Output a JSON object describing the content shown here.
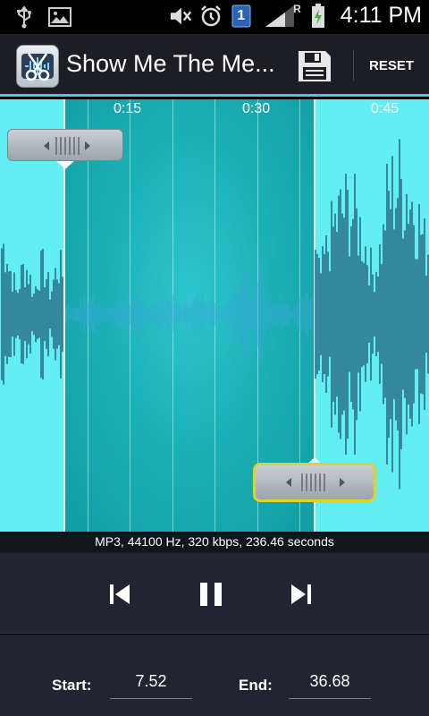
{
  "status_bar": {
    "time": "4:11 PM",
    "notification_badge": "1",
    "roaming_indicator": "R",
    "icons": [
      "usb-icon",
      "image-icon",
      "mute-icon",
      "alarm-icon",
      "notification-badge-icon",
      "signal-icon",
      "battery-charging-icon"
    ]
  },
  "action_bar": {
    "title": "Show Me The Me...",
    "app_icon": "scissors-app-icon",
    "save_icon": "floppy-save-icon",
    "reset_label": "RESET"
  },
  "waveform": {
    "time_marks": [
      "0:15",
      "0:30",
      "0:45"
    ],
    "selection_color": "#1bb1b6",
    "background_color": "#62eef2",
    "wave_color": "#2a6f86",
    "active_handle_color": "#e5cf2a"
  },
  "file_info": "MP3, 44100 Hz, 320 kbps, 236.46 seconds",
  "controls": {
    "prev_icon": "skip-previous-icon",
    "pause_icon": "pause-icon",
    "next_icon": "skip-next-icon"
  },
  "range": {
    "start_label": "Start:",
    "start_value": "7.52",
    "end_label": "End:",
    "end_value": "36.68"
  }
}
